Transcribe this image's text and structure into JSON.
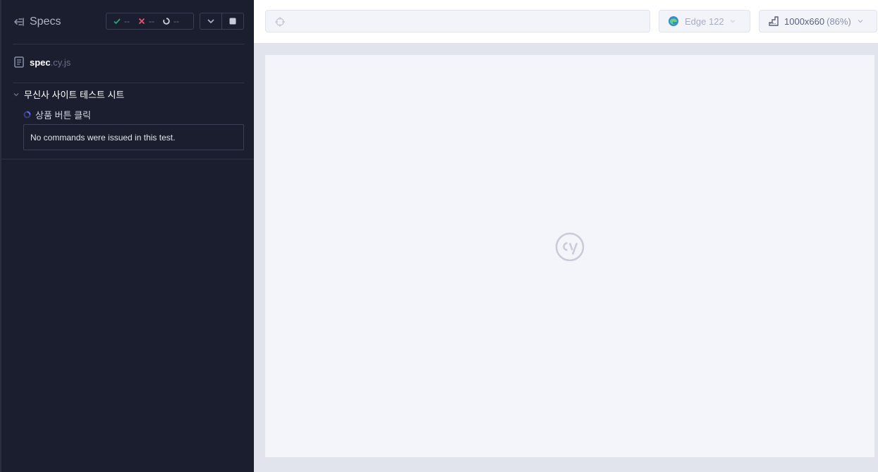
{
  "sidebar": {
    "title": "Specs",
    "stats": {
      "passed": "--",
      "failed": "--",
      "pending": "--"
    },
    "spec": {
      "name": "spec",
      "ext": ".cy.js"
    },
    "suite": {
      "title": "무신사 사이트 테스트 시트"
    },
    "test": {
      "title": "상품 버튼 클릭",
      "message": "No commands were issued in this test."
    }
  },
  "topbar": {
    "url": "",
    "browser": "Edge 122",
    "viewport": "1000x660",
    "scale": "(86%)"
  },
  "icons": {
    "back": "arrow-left-icon",
    "passed": "check-icon",
    "failed": "x-icon",
    "pending": "spinner-icon",
    "collapse": "chevron-down-icon",
    "stop": "stop-icon",
    "file": "document-icon",
    "crosshair": "crosshair-icon",
    "browser": "edge-icon",
    "viewport": "ruler-icon",
    "logo": "cypress-logo-icon"
  },
  "colors": {
    "sidebar_bg": "#1b1e2e",
    "passed": "#1fa971",
    "failed": "#e45770",
    "running": "#6470f3"
  }
}
